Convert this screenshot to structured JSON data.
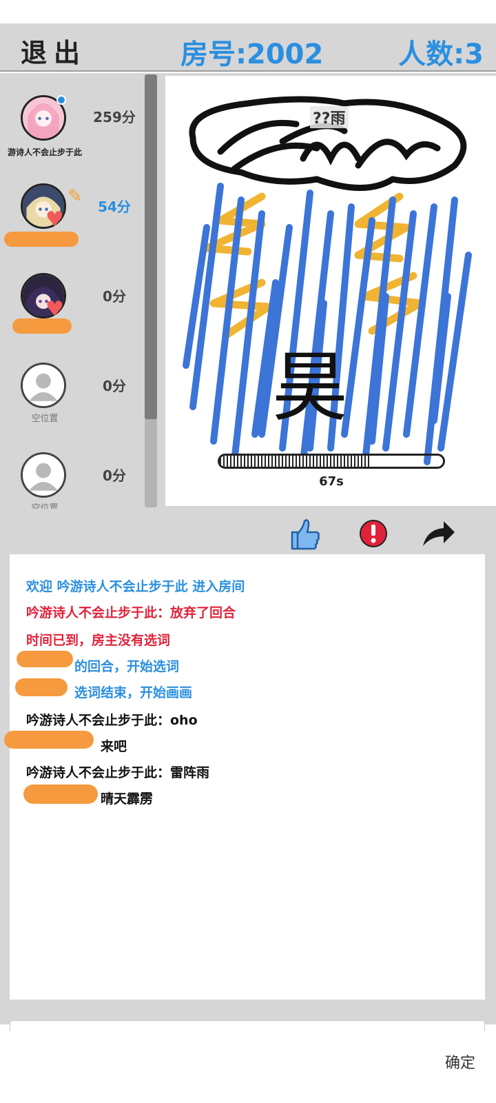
{
  "header": {
    "exit_label": "退出",
    "room_label": "房号:2002",
    "count_label": "人数:3"
  },
  "players": [
    {
      "name": "游诗人不会止步于此",
      "score": "259分"
    },
    {
      "name": "",
      "score": "54分"
    },
    {
      "name": "",
      "score": "0分"
    },
    {
      "name": "空位置",
      "score": "0分"
    },
    {
      "name": "空位置",
      "score": "0分"
    }
  ],
  "canvas": {
    "hint": "??雨",
    "drawn_text": "昊",
    "timer_text": "67s",
    "timer_fraction": 0.67
  },
  "chat": {
    "messages": [
      {
        "type": "sys",
        "text": "欢迎 吟游诗人不会止步于此 进入房间"
      },
      {
        "type": "warn",
        "text": "吟游诗人不会止步于此：放弃了回合"
      },
      {
        "type": "warn",
        "text": "时间已到，房主没有选词"
      },
      {
        "type": "sys",
        "text": "的回合，开始选词"
      },
      {
        "type": "sys",
        "text": "选词结束，开始画画"
      },
      {
        "type": "chat",
        "text": "吟游诗人不会止步于此：oho"
      },
      {
        "type": "chat",
        "text": "来吧"
      },
      {
        "type": "chat",
        "text": "吟游诗人不会止步于此：雷阵雨"
      },
      {
        "type": "chat",
        "text": "晴天霹雳"
      }
    ]
  },
  "footer": {
    "confirm_label": "确定"
  },
  "colors": {
    "accent": "#2a8fe0",
    "warning": "#e0233a",
    "redaction": "#f59a3e"
  }
}
